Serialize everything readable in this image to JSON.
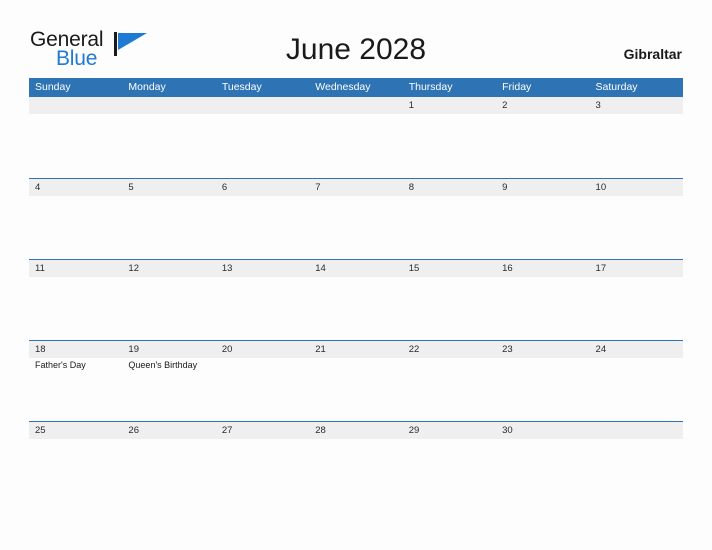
{
  "brand": {
    "name_part1": "General",
    "name_part2": "Blue",
    "flag_color": "#1f7ad4"
  },
  "header": {
    "title": "June 2028",
    "country": "Gibraltar"
  },
  "theme": {
    "header_blue": "#2e74b5",
    "band_gray": "#efefef",
    "page_background": "#fdfdfd",
    "text_dark": "#1a1a1a"
  },
  "calendar": {
    "weekdays": [
      "Sunday",
      "Monday",
      "Tuesday",
      "Wednesday",
      "Thursday",
      "Friday",
      "Saturday"
    ],
    "weeks": [
      [
        {
          "day": "",
          "events": []
        },
        {
          "day": "",
          "events": []
        },
        {
          "day": "",
          "events": []
        },
        {
          "day": "",
          "events": []
        },
        {
          "day": "1",
          "events": []
        },
        {
          "day": "2",
          "events": []
        },
        {
          "day": "3",
          "events": []
        }
      ],
      [
        {
          "day": "4",
          "events": []
        },
        {
          "day": "5",
          "events": []
        },
        {
          "day": "6",
          "events": []
        },
        {
          "day": "7",
          "events": []
        },
        {
          "day": "8",
          "events": []
        },
        {
          "day": "9",
          "events": []
        },
        {
          "day": "10",
          "events": []
        }
      ],
      [
        {
          "day": "11",
          "events": []
        },
        {
          "day": "12",
          "events": []
        },
        {
          "day": "13",
          "events": []
        },
        {
          "day": "14",
          "events": []
        },
        {
          "day": "15",
          "events": []
        },
        {
          "day": "16",
          "events": []
        },
        {
          "day": "17",
          "events": []
        }
      ],
      [
        {
          "day": "18",
          "events": [
            "Father's Day"
          ]
        },
        {
          "day": "19",
          "events": [
            "Queen's Birthday"
          ]
        },
        {
          "day": "20",
          "events": []
        },
        {
          "day": "21",
          "events": []
        },
        {
          "day": "22",
          "events": []
        },
        {
          "day": "23",
          "events": []
        },
        {
          "day": "24",
          "events": []
        }
      ],
      [
        {
          "day": "25",
          "events": []
        },
        {
          "day": "26",
          "events": []
        },
        {
          "day": "27",
          "events": []
        },
        {
          "day": "28",
          "events": []
        },
        {
          "day": "29",
          "events": []
        },
        {
          "day": "30",
          "events": []
        },
        {
          "day": "",
          "events": []
        }
      ]
    ]
  }
}
